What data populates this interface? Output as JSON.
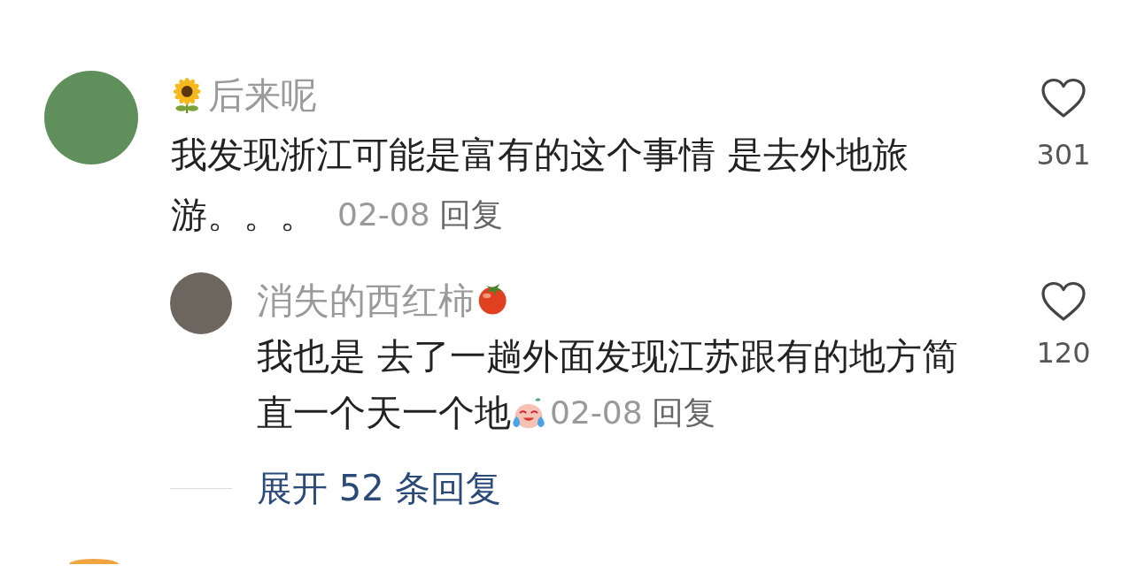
{
  "comments": [
    {
      "user": "后来呢",
      "text_lines": [
        "我发现浙江可能是富有的这个事情 是去外地旅",
        "游。。。"
      ],
      "date": "02-08",
      "reply_label": "回复",
      "likes": "301",
      "replies": [
        {
          "user": "消失的西红柿",
          "text_lines": [
            "我也是 去了一趟外面发现江苏跟有的地方简",
            "直一个天一个地"
          ],
          "date": "02-08",
          "reply_label": "回复",
          "likes": "120"
        }
      ],
      "expand_replies": "展开 52 条回复"
    }
  ]
}
